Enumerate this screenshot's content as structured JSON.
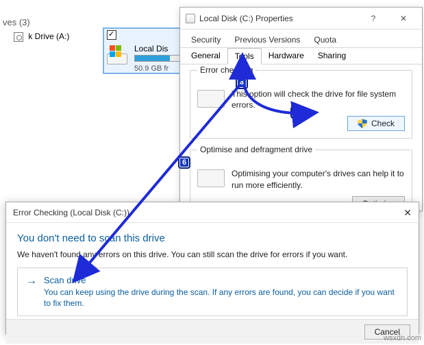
{
  "explorer": {
    "ves_label": "ves (3)",
    "sidebar_drive": "k Drive (A:)",
    "tile": {
      "title": "Local Dis",
      "subtitle": "50.9 GB fr"
    }
  },
  "props": {
    "title": "Local Disk (C:) Properties",
    "row1": {
      "security": "Security",
      "prev": "Previous Versions",
      "quota": "Quota"
    },
    "row2": {
      "general": "General",
      "tools": "Tools",
      "hardware": "Hardware",
      "sharing": "Sharing"
    },
    "error_check": {
      "legend": "Error checking",
      "text": "This option will check the drive for file system errors.",
      "button": "Check"
    },
    "optimize": {
      "legend": "Optimise and defragment drive",
      "text": "Optimising your computer's drives can help it to run more efficiently.",
      "button": "Optimise"
    }
  },
  "dlg": {
    "title": "Error Checking (Local Disk (C:))",
    "heading": "You don't need to scan this drive",
    "body": "We haven't found any errors on this drive. You can still scan the drive for errors if you want.",
    "opt_title": "Scan drive",
    "opt_sub": "You can keep using the drive during the scan. If any errors are found, you can decide if you want to fix them.",
    "cancel": "Cancel"
  },
  "badges": {
    "b4": "4",
    "b5": "5",
    "b6": "6"
  },
  "watermark": "wsxdn.com"
}
